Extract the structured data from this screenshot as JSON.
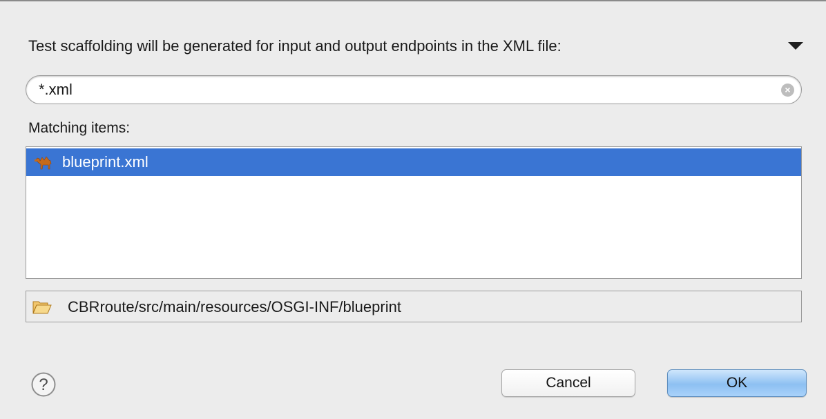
{
  "dialog": {
    "instruction": "Test scaffolding will be generated for input and output endpoints in the XML file:",
    "menu_icon": "triangle-down-icon"
  },
  "search": {
    "value": "*.xml",
    "clear_icon": "clear-search-icon"
  },
  "matching": {
    "label": "Matching items:",
    "items": [
      {
        "label": "blueprint.xml",
        "icon": "camel-icon",
        "selected": true
      }
    ]
  },
  "location": {
    "icon": "folder-open-icon",
    "path": "CBRroute/src/main/resources/OSGI-INF/blueprint"
  },
  "buttons": {
    "help_icon": "help-icon",
    "cancel": "Cancel",
    "ok": "OK"
  },
  "colors": {
    "selection": "#3a75d3",
    "background": "#ececec",
    "ok_button": "#8dc0f2"
  }
}
